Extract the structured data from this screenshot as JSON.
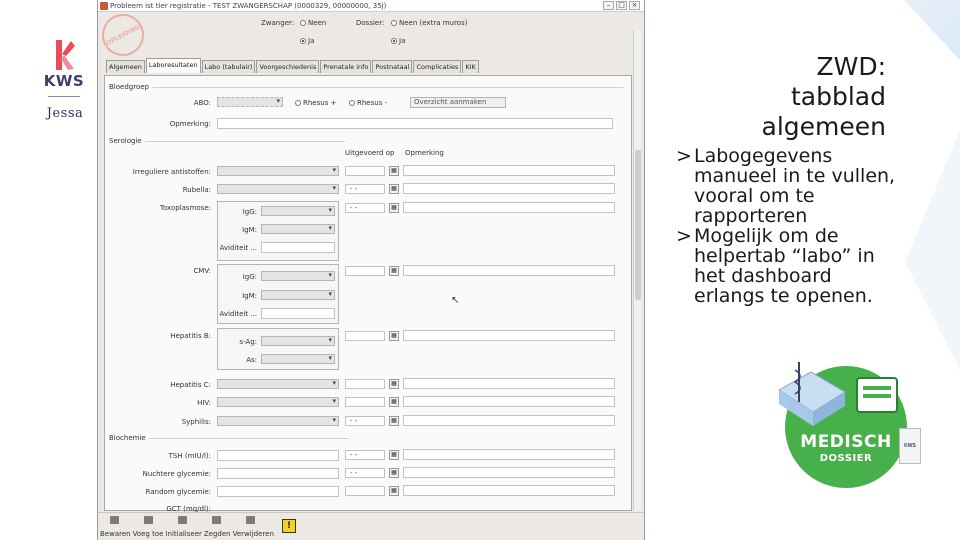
{
  "logo": {
    "brand": "KWS",
    "partner": "Jessa"
  },
  "slide": {
    "title_line1": "ZWD:",
    "title_line2": "tabblad algemeen",
    "bullets": [
      {
        "marker": ">",
        "text": "Labogegevens manueel in te vullen, vooral om te rapporteren"
      },
      {
        "marker": ">",
        "text": "Mogelijk om de helpertab “labo” in het dashboard erlangs te openen."
      }
    ]
  },
  "badge": {
    "line1": "MEDISCH",
    "line2": "DOSSIER",
    "mini": "KWS"
  },
  "app": {
    "title": "Probleem ist tier registratie - TEST ZWANGERSCHAP (0000329, 00000000, 35j)",
    "stamp": "OPLEIDING",
    "header": {
      "zwanger_label": "Zwanger:",
      "zwanger_opts": [
        "Neen",
        "Ja"
      ],
      "dossier_label": "Dossier:",
      "dossier_opts": [
        "Neen (extra muros)",
        "Ja"
      ]
    },
    "tabs": [
      "Algemeen",
      "Laboresultaten",
      "Labo (tabulair)",
      "Voorgeschiedenis",
      "Prenatale info",
      "Postnataal",
      "Complicaties",
      "KIK"
    ],
    "sections": {
      "bloedgroep": "Bloedgroep",
      "serologie": "Serologie",
      "biochemie": "Biochemie"
    },
    "bloedgroep": {
      "abo_label": "ABO:",
      "rhesus_pos": "Rhesus +",
      "rhesus_neg": "Rhesus -",
      "overview_btn": "Overzicht aanmaken",
      "opmerking_label": "Opmerking:"
    },
    "serologie_cols": {
      "uitgevoerd": "Uitgevoerd op",
      "opmerking": "Opmerking"
    },
    "serologie_rows": {
      "irreg": "Irreguliere antistoffen:",
      "rubella": "Rubella:",
      "toxo": "Toxoplasmose:",
      "cmv": "CMV:",
      "hepb": "Hepatitis B:",
      "hepc": "Hepatitis C:",
      "hiv": "HIV:",
      "syphilis": "Syphilis:"
    },
    "sub": {
      "igg": "IgG:",
      "igm": "IgM:",
      "aviditeit": "Aviditeit ...",
      "hbsag": "s-Ag:",
      "hbsas": "As:"
    },
    "date_placeholder": "- -",
    "biochemie_rows": {
      "tsh": "TSH (mIU/l):",
      "nuchtere": "Nuchtere glycemie:",
      "random": "Random glycemie:",
      "gct": "GCT (mg/dl):"
    },
    "toolbar": [
      "Bewaren",
      "Voeg toe",
      "Initialiseer",
      "Zegden",
      "Verwijderen"
    ],
    "warn_icon": "warning-icon"
  }
}
